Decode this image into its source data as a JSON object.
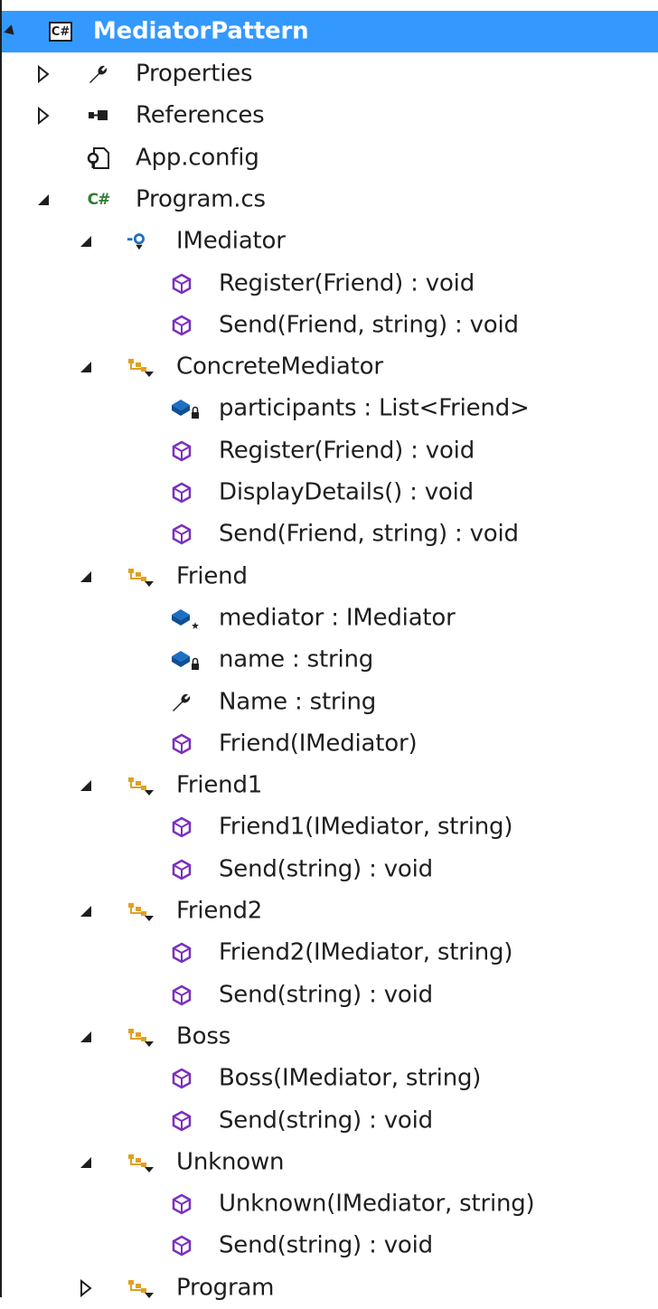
{
  "solution_explorer": {
    "project": {
      "label": "MediatorPattern",
      "icon": "csharp-project-icon",
      "expanded": true,
      "selected": true
    },
    "items": [
      {
        "label": "Properties",
        "icon": "wrench-icon",
        "level": 1,
        "expander": "collapsed"
      },
      {
        "label": "References",
        "icon": "references-icon",
        "level": 1,
        "expander": "collapsed"
      },
      {
        "label": "App.config",
        "icon": "config-file-icon",
        "level": 1,
        "expander": "none"
      },
      {
        "label": "Program.cs",
        "icon": "csharp-file-icon",
        "level": 1,
        "expander": "expanded"
      },
      {
        "label": "IMediator",
        "icon": "interface-icon",
        "level": 2,
        "expander": "expanded"
      },
      {
        "label": "Register(Friend) : void",
        "icon": "method-icon",
        "level": 3,
        "expander": "none"
      },
      {
        "label": "Send(Friend, string) : void",
        "icon": "method-icon",
        "level": 3,
        "expander": "none"
      },
      {
        "label": "ConcreteMediator",
        "icon": "class-icon",
        "level": 2,
        "expander": "expanded"
      },
      {
        "label": "participants : List<Friend>",
        "icon": "private-field-icon",
        "level": 3,
        "expander": "none"
      },
      {
        "label": "Register(Friend) : void",
        "icon": "method-icon",
        "level": 3,
        "expander": "none"
      },
      {
        "label": "DisplayDetails() : void",
        "icon": "method-icon",
        "level": 3,
        "expander": "none"
      },
      {
        "label": "Send(Friend, string) : void",
        "icon": "method-icon",
        "level": 3,
        "expander": "none"
      },
      {
        "label": "Friend",
        "icon": "class-icon",
        "level": 2,
        "expander": "expanded"
      },
      {
        "label": "mediator : IMediator",
        "icon": "protected-field-icon",
        "level": 3,
        "expander": "none"
      },
      {
        "label": "name : string",
        "icon": "private-field-icon",
        "level": 3,
        "expander": "none"
      },
      {
        "label": "Name : string",
        "icon": "property-wrench-icon",
        "level": 3,
        "expander": "none"
      },
      {
        "label": "Friend(IMediator)",
        "icon": "method-icon",
        "level": 3,
        "expander": "none"
      },
      {
        "label": "Friend1",
        "icon": "class-icon",
        "level": 2,
        "expander": "expanded"
      },
      {
        "label": "Friend1(IMediator, string)",
        "icon": "method-icon",
        "level": 3,
        "expander": "none"
      },
      {
        "label": "Send(string) : void",
        "icon": "method-icon",
        "level": 3,
        "expander": "none"
      },
      {
        "label": "Friend2",
        "icon": "class-icon",
        "level": 2,
        "expander": "expanded"
      },
      {
        "label": "Friend2(IMediator, string)",
        "icon": "method-icon",
        "level": 3,
        "expander": "none"
      },
      {
        "label": "Send(string) : void",
        "icon": "method-icon",
        "level": 3,
        "expander": "none"
      },
      {
        "label": "Boss",
        "icon": "class-icon",
        "level": 2,
        "expander": "expanded"
      },
      {
        "label": "Boss(IMediator, string)",
        "icon": "method-icon",
        "level": 3,
        "expander": "none"
      },
      {
        "label": "Send(string) : void",
        "icon": "method-icon",
        "level": 3,
        "expander": "none"
      },
      {
        "label": "Unknown",
        "icon": "class-icon",
        "level": 2,
        "expander": "expanded"
      },
      {
        "label": "Unknown(IMediator, string)",
        "icon": "method-icon",
        "level": 3,
        "expander": "none"
      },
      {
        "label": "Send(string) : void",
        "icon": "method-icon",
        "level": 3,
        "expander": "none"
      },
      {
        "label": "Program",
        "icon": "class-icon",
        "level": 2,
        "expander": "collapsed"
      }
    ],
    "colors": {
      "selection": "#3399ff",
      "method": "#7b2fbf",
      "field": "#1e6fc4",
      "class": "#e0a020",
      "csharp": "#2e7d32"
    }
  }
}
